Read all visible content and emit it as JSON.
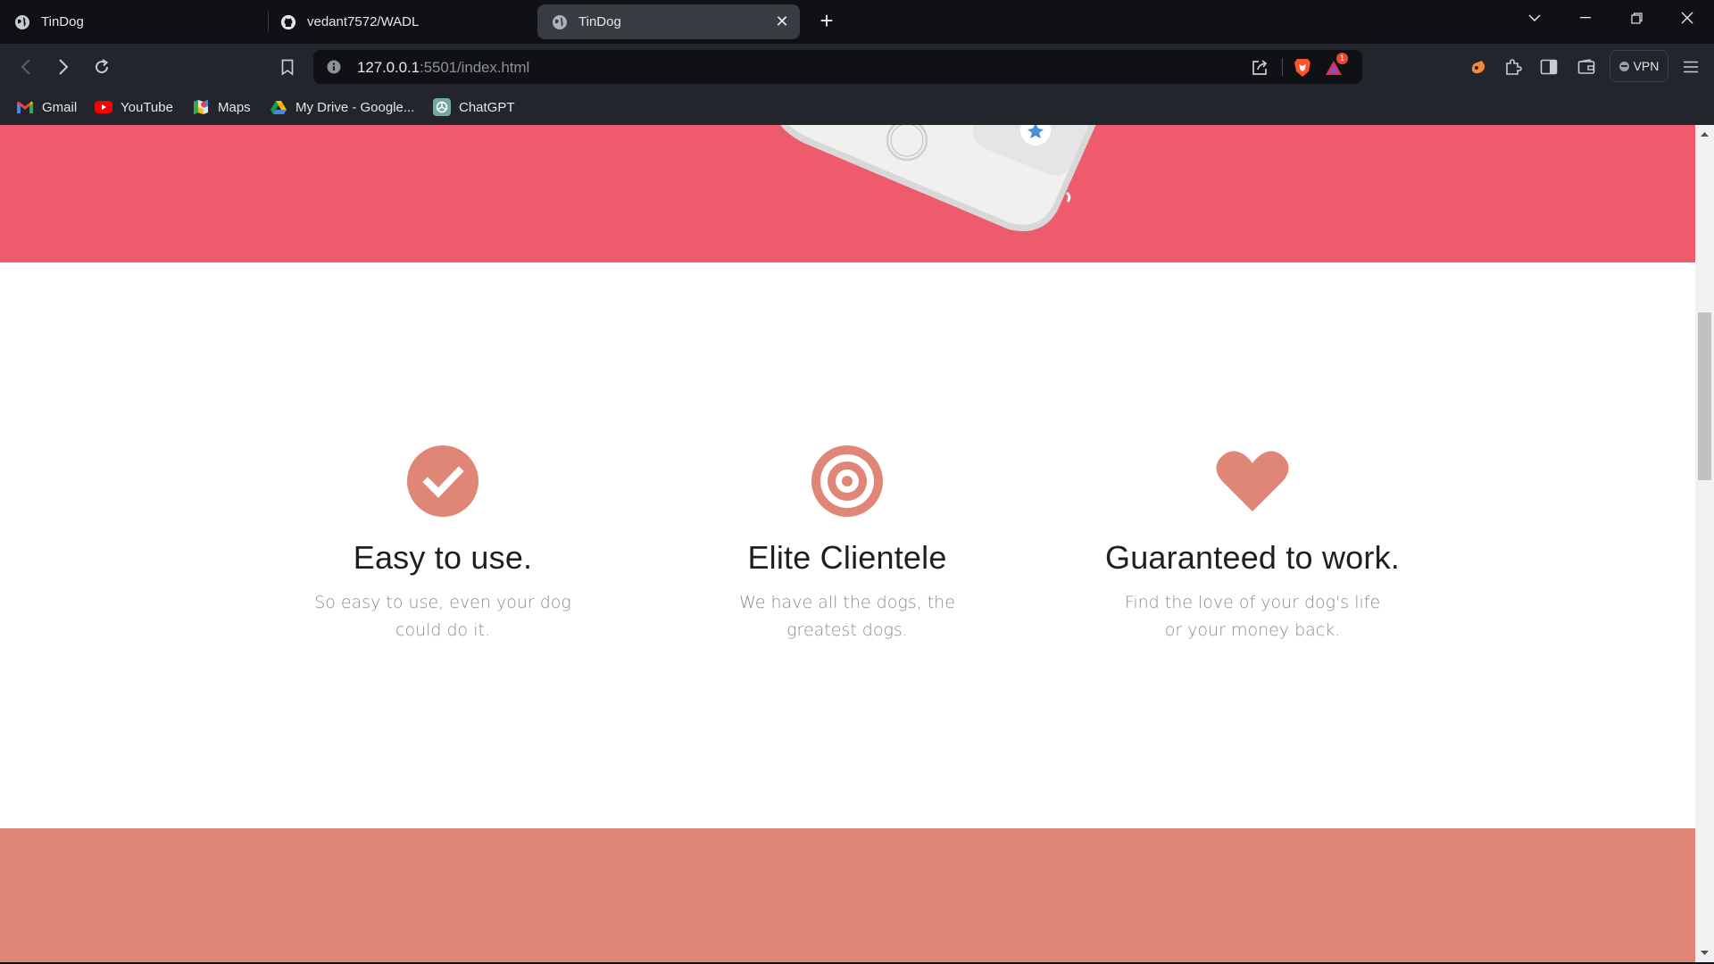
{
  "tabs": [
    {
      "title": "TinDog",
      "icon": "globe-icon",
      "active": false
    },
    {
      "title": "vedant7572/WADL",
      "icon": "github-icon",
      "active": false
    },
    {
      "title": "TinDog",
      "icon": "globe-icon",
      "active": true
    }
  ],
  "toolbar": {
    "url_host": "127.0.0.1",
    "url_rest": ":5501/index.html",
    "vpn_label": "VPN",
    "alert_badge": "1"
  },
  "bookmarks": [
    {
      "label": "Gmail",
      "icon": "gmail-icon"
    },
    {
      "label": "YouTube",
      "icon": "youtube-icon"
    },
    {
      "label": "Maps",
      "icon": "maps-icon"
    },
    {
      "label": "My Drive - Google...",
      "icon": "google-drive-icon"
    },
    {
      "label": "ChatGPT",
      "icon": "chatgpt-icon"
    }
  ],
  "features": [
    {
      "title": "Easy to use.",
      "text": "So easy to use, even your dog could do it.",
      "icon": "check-circle-icon"
    },
    {
      "title": "Elite Clientele",
      "text": "We have all the dogs, the greatest dogs.",
      "icon": "bullseye-icon"
    },
    {
      "title": "Guaranteed to work.",
      "text": "Find the love of your dog's life or your money back.",
      "icon": "heart-icon"
    }
  ],
  "colors": {
    "hero_bg": "#ee5b6d",
    "icon_accent": "#e08677",
    "bottom_band": "#e08677",
    "heading": "#1d1f22",
    "body_text": "#8b8b8b"
  }
}
